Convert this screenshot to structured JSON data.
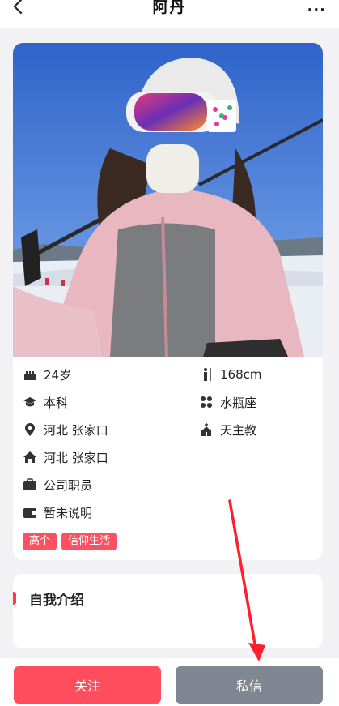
{
  "header": {
    "title": "阿丹",
    "more_label": "···"
  },
  "profile": {
    "info_left": [
      {
        "icon": "cake-icon",
        "text": "24岁"
      },
      {
        "icon": "graduation-cap-icon",
        "text": "本科"
      },
      {
        "icon": "location-pin-icon",
        "text": "河北 张家口"
      },
      {
        "icon": "home-icon",
        "text": "河北 张家口"
      },
      {
        "icon": "briefcase-icon",
        "text": "公司职员"
      },
      {
        "icon": "wallet-icon",
        "text": "暂未说明"
      }
    ],
    "info_right": [
      {
        "icon": "height-person-icon",
        "text": "168cm"
      },
      {
        "icon": "zodiac-icon",
        "text": "水瓶座"
      },
      {
        "icon": "church-icon",
        "text": "天主教"
      }
    ],
    "tags": [
      "高个",
      "信仰生活"
    ]
  },
  "intro": {
    "title": "自我介绍"
  },
  "actions": {
    "follow_label": "关注",
    "message_label": "私信"
  },
  "colors": {
    "accent": "#ff4d5e",
    "secondary_button": "#808692",
    "annotation_arrow": "#ff1e2d"
  }
}
